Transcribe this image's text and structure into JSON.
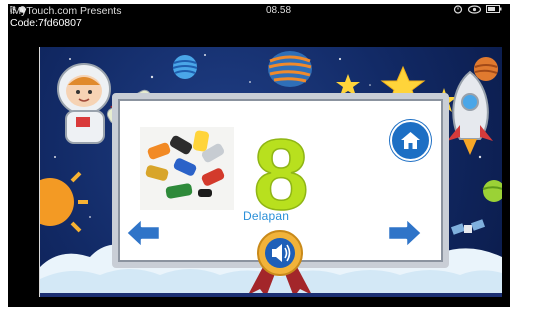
{
  "status_bar": {
    "time": "08.58",
    "left_icons": [
      "usb-icon",
      "android-icon"
    ],
    "right_icons": [
      "alarm-icon",
      "eye-icon",
      "battery-icon"
    ]
  },
  "overlay": {
    "line1": "iMyTouch.com Presents",
    "line2": "Code:7fd60807"
  },
  "lesson": {
    "number": "8",
    "word": "Delapan",
    "image_icon": "toy-cars-image"
  },
  "controls": {
    "home_icon": "home-icon",
    "prev_icon": "arrow-left-icon",
    "next_icon": "arrow-right-icon",
    "sound_icon": "speaker-icon"
  },
  "colors": {
    "space_bg": "#122a66",
    "number_green": "#b8e01e",
    "word_blue": "#2a8fd8",
    "arrow_blue": "#2f74c8",
    "home_blue": "#1d6fc4",
    "ribbon_red": "#a3262a"
  }
}
